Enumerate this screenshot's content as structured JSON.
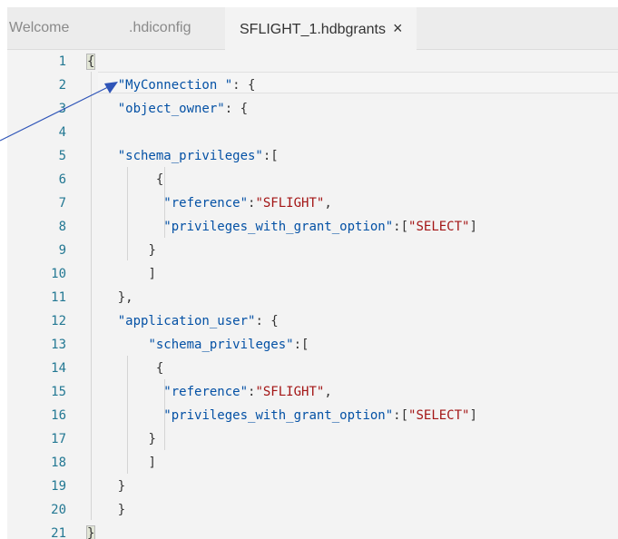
{
  "tabs": [
    {
      "label": "Welcome",
      "active": false
    },
    {
      "label": ".hdiconfig",
      "active": false
    },
    {
      "label": "SFLIGHT_1.hdbgrants",
      "active": true
    }
  ],
  "close_glyph": "×",
  "code": {
    "lines": [
      {
        "n": "1",
        "indent": "",
        "parts": [
          {
            "t": "p",
            "v": "{"
          }
        ],
        "bracket": true
      },
      {
        "n": "2",
        "indent": "    ",
        "parts": [
          {
            "t": "k",
            "v": "\"MyConnection \""
          },
          {
            "t": "p",
            "v": ": {"
          }
        ]
      },
      {
        "n": "3",
        "indent": "    ",
        "parts": [
          {
            "t": "k",
            "v": "\"object_owner\""
          },
          {
            "t": "p",
            "v": ": {"
          }
        ]
      },
      {
        "n": "4",
        "indent": "",
        "parts": []
      },
      {
        "n": "5",
        "indent": "    ",
        "parts": [
          {
            "t": "k",
            "v": "\"schema_privileges\""
          },
          {
            "t": "p",
            "v": ":["
          }
        ]
      },
      {
        "n": "6",
        "indent": "         ",
        "parts": [
          {
            "t": "p",
            "v": "{"
          }
        ]
      },
      {
        "n": "7",
        "indent": "          ",
        "parts": [
          {
            "t": "k",
            "v": "\"reference\""
          },
          {
            "t": "p",
            "v": ":"
          },
          {
            "t": "s",
            "v": "\"SFLIGHT\""
          },
          {
            "t": "p",
            "v": ","
          }
        ]
      },
      {
        "n": "8",
        "indent": "          ",
        "parts": [
          {
            "t": "k",
            "v": "\"privileges_with_grant_option\""
          },
          {
            "t": "p",
            "v": ":["
          },
          {
            "t": "s",
            "v": "\"SELECT\""
          },
          {
            "t": "p",
            "v": "]"
          }
        ]
      },
      {
        "n": "9",
        "indent": "        ",
        "parts": [
          {
            "t": "p",
            "v": "}"
          }
        ]
      },
      {
        "n": "10",
        "indent": "        ",
        "parts": [
          {
            "t": "p",
            "v": "]"
          }
        ]
      },
      {
        "n": "11",
        "indent": "    ",
        "parts": [
          {
            "t": "p",
            "v": "},"
          }
        ]
      },
      {
        "n": "12",
        "indent": "    ",
        "parts": [
          {
            "t": "k",
            "v": "\"application_user\""
          },
          {
            "t": "p",
            "v": ": {"
          }
        ]
      },
      {
        "n": "13",
        "indent": "        ",
        "parts": [
          {
            "t": "k",
            "v": "\"schema_privileges\""
          },
          {
            "t": "p",
            "v": ":["
          }
        ]
      },
      {
        "n": "14",
        "indent": "         ",
        "parts": [
          {
            "t": "p",
            "v": "{"
          }
        ]
      },
      {
        "n": "15",
        "indent": "          ",
        "parts": [
          {
            "t": "k",
            "v": "\"reference\""
          },
          {
            "t": "p",
            "v": ":"
          },
          {
            "t": "s",
            "v": "\"SFLIGHT\""
          },
          {
            "t": "p",
            "v": ","
          }
        ]
      },
      {
        "n": "16",
        "indent": "          ",
        "parts": [
          {
            "t": "k",
            "v": "\"privileges_with_grant_option\""
          },
          {
            "t": "p",
            "v": ":["
          },
          {
            "t": "s",
            "v": "\"SELECT\""
          },
          {
            "t": "p",
            "v": "]"
          }
        ]
      },
      {
        "n": "17",
        "indent": "        ",
        "parts": [
          {
            "t": "p",
            "v": "}"
          }
        ]
      },
      {
        "n": "18",
        "indent": "        ",
        "parts": [
          {
            "t": "p",
            "v": "]"
          }
        ]
      },
      {
        "n": "19",
        "indent": "    ",
        "parts": [
          {
            "t": "p",
            "v": "}"
          }
        ]
      },
      {
        "n": "20",
        "indent": "    ",
        "parts": [
          {
            "t": "p",
            "v": "}"
          }
        ]
      },
      {
        "n": "21",
        "indent": "",
        "parts": [
          {
            "t": "p",
            "v": "}"
          }
        ],
        "bracket": true
      }
    ]
  },
  "colors": {
    "line_number": "#237893",
    "json_key": "#0451a5",
    "json_string": "#a31515",
    "punctuation": "#333333",
    "annotation_arrow": "#2f55b8"
  }
}
